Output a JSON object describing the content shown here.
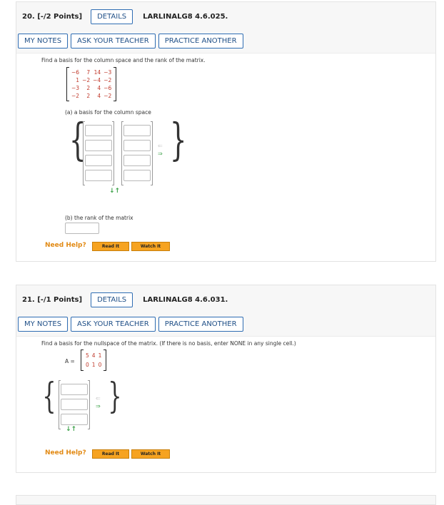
{
  "common": {
    "details": "DETAILS",
    "my_notes": "MY NOTES",
    "ask_teacher": "ASK YOUR TEACHER",
    "practice_another": "PRACTICE ANOTHER",
    "need_help": "Need Help?",
    "read_it": "Read It",
    "watch_it": "Watch It"
  },
  "q20": {
    "number": "20. [-/2 Points]",
    "code": "LARLINALG8 4.6.025.",
    "prompt": "Find a basis for the column space and the rank of the matrix.",
    "matrix": [
      [
        "−6",
        "7",
        "14",
        "−3"
      ],
      [
        "1",
        "−2",
        "−4",
        "−2"
      ],
      [
        "−3",
        "2",
        "4",
        "−6"
      ],
      [
        "−2",
        "2",
        "4",
        "−2"
      ]
    ],
    "part_a": "(a) a basis for the column space",
    "part_b": "(b) the rank of the matrix"
  },
  "q21": {
    "number": "21. [-/1 Points]",
    "code": "LARLINALG8 4.6.031.",
    "prompt": "Find a basis for the nullspace of the matrix. (If there is no basis, enter NONE in any single cell.)",
    "matrix_label": "A =",
    "matrix": [
      [
        "5",
        "4",
        "1"
      ],
      [
        "0",
        "1",
        "0"
      ]
    ]
  }
}
